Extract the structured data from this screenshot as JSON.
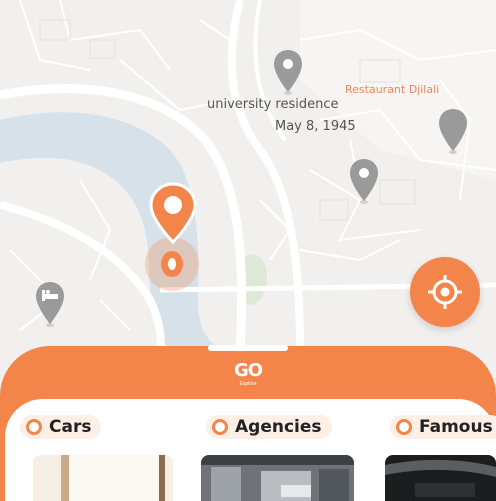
{
  "map": {
    "place_label_line1": "university  residence",
    "place_label_line2": "May 8, 1945",
    "restaurant_label": "Restaurant Djilali",
    "colors": {
      "land": "#f1f0ef",
      "road": "#ffffff",
      "river": "#d6e1e9",
      "park": "#dfe8d6",
      "pin_gray": "#9a9a9a",
      "accent": "#f3854a"
    }
  },
  "icons": {
    "locate": "crosshair-target-icon",
    "user_location": "orange-location-pin-icon",
    "hotel": "bed-pin-icon"
  },
  "brand": {
    "logo_text": "GO",
    "logo_sub": "Explore"
  },
  "categories": [
    {
      "label": "Cars"
    },
    {
      "label": "Agencies"
    },
    {
      "label": "Famous"
    }
  ]
}
